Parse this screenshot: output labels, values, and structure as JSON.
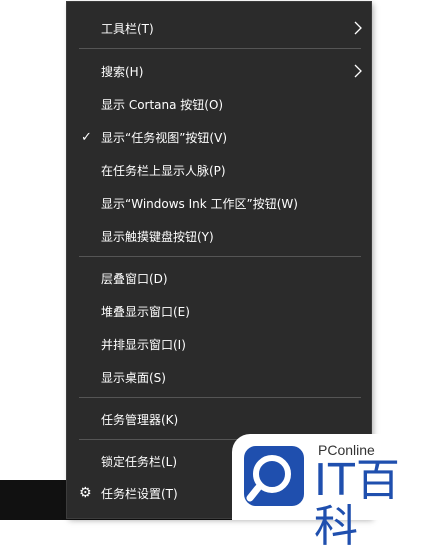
{
  "menu": {
    "items": [
      {
        "label": "工具栏(T)",
        "submenu": true
      },
      {
        "label": "搜索(H)",
        "submenu": true
      },
      {
        "label": "显示 Cortana 按钮(O)"
      },
      {
        "label": "显示“任务视图”按钮(V)",
        "checked": true
      },
      {
        "label": "在任务栏上显示人脉(P)"
      },
      {
        "label": "显示“Windows Ink 工作区”按钮(W)"
      },
      {
        "label": "显示触摸键盘按钮(Y)"
      },
      {
        "label": "层叠窗口(D)"
      },
      {
        "label": "堆叠显示窗口(E)"
      },
      {
        "label": "并排显示窗口(I)"
      },
      {
        "label": "显示桌面(S)"
      },
      {
        "label": "任务管理器(K)"
      },
      {
        "label": "锁定任务栏(L)"
      },
      {
        "label": "任务栏设置(T)",
        "icon": "gear-icon"
      }
    ],
    "check_glyph": "✓",
    "gear_glyph": "⚙"
  },
  "watermark": {
    "line1": "PConline",
    "line2": "IT百科",
    "accent": "#1f4fae"
  }
}
